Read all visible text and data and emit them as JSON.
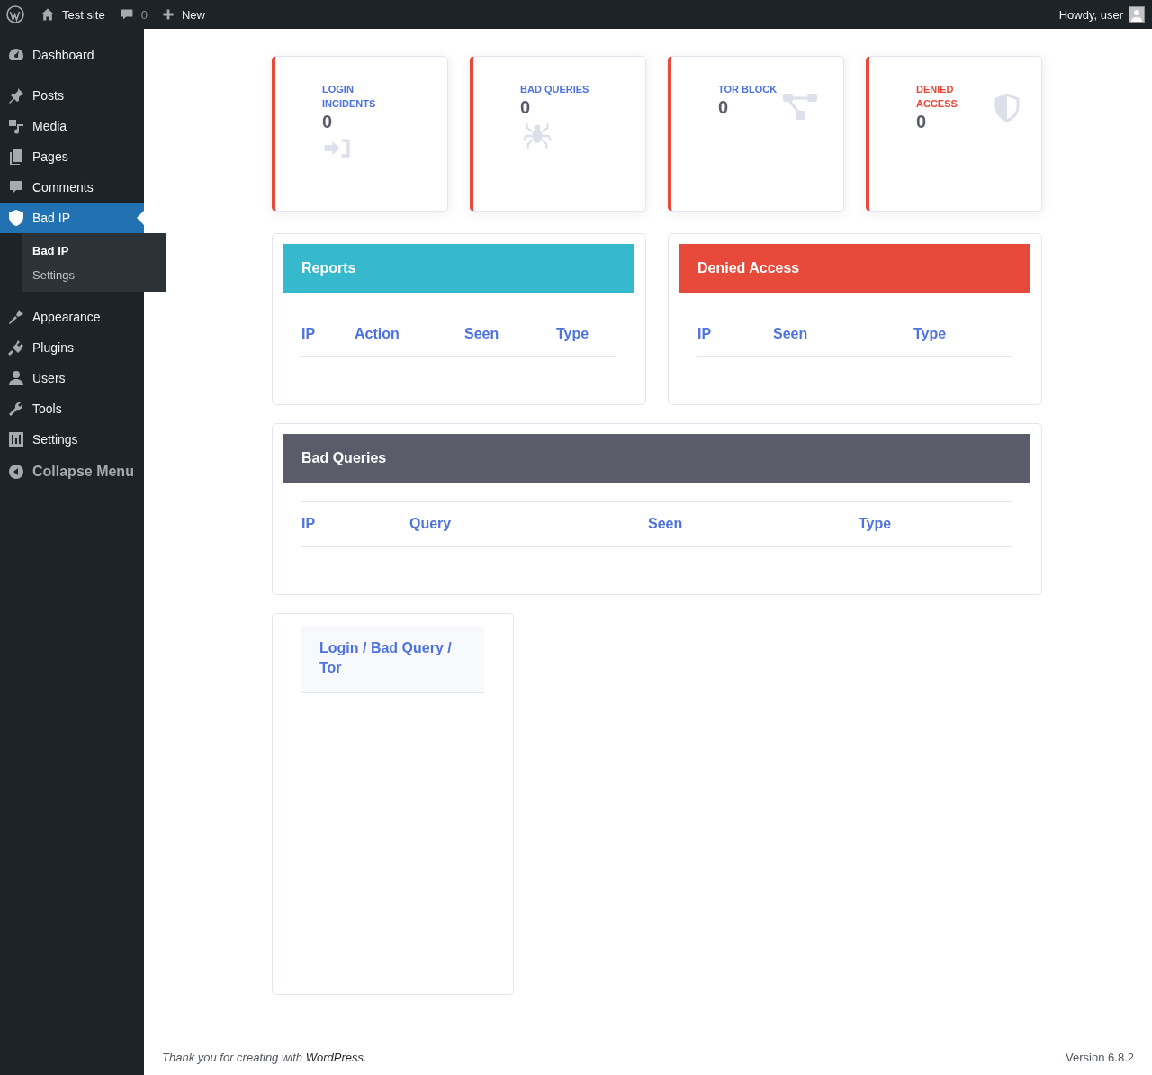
{
  "admin_bar": {
    "site": "Test site",
    "comments": "0",
    "new": "New",
    "greeting": "Howdy, user"
  },
  "sidebar": {
    "items": [
      {
        "label": "Dashboard",
        "selected": false
      },
      {
        "label": "Posts",
        "selected": false
      },
      {
        "label": "Media",
        "selected": false
      },
      {
        "label": "Pages",
        "selected": false
      },
      {
        "label": "Comments",
        "selected": false
      },
      {
        "label": "Bad IP",
        "selected": true,
        "children": [
          {
            "label": "Bad IP",
            "selected": true
          },
          {
            "label": "Settings",
            "selected": false
          }
        ]
      },
      {
        "label": "Appearance",
        "selected": false
      },
      {
        "label": "Plugins",
        "selected": false
      },
      {
        "label": "Users",
        "selected": false
      },
      {
        "label": "Tools",
        "selected": false
      },
      {
        "label": "Settings",
        "selected": false
      }
    ],
    "collapse": "Collapse Menu"
  },
  "stats": [
    {
      "label": "LOGIN INCIDENTS",
      "value": "0",
      "kind": "login",
      "color": "#4e73df"
    },
    {
      "label": "BAD QUERIES",
      "value": "0",
      "kind": "bug",
      "color": "#4e73df"
    },
    {
      "label": "TOR BLOCK",
      "value": "0",
      "kind": "network",
      "color": "#4e73df"
    },
    {
      "label": "DENIED ACCESS",
      "value": "0",
      "kind": "shield",
      "color": "#e74a3b"
    }
  ],
  "panels": [
    {
      "title": "Reports",
      "color": "#36b9cc",
      "columns": [
        "IP",
        "Action",
        "Seen",
        "Type"
      ]
    },
    {
      "title": "Denied Access",
      "color": "#e74a3b",
      "columns": [
        "IP",
        "Seen",
        "Type"
      ]
    },
    {
      "title": "Bad Queries",
      "color": "#5a5c69",
      "columns": [
        "IP",
        "Query",
        "Seen",
        "Type"
      ]
    }
  ],
  "chart_card": {
    "heading": "Login / Bad Query / Tor"
  },
  "footer": {
    "text_before": "Thank you for creating with ",
    "link": "WordPress",
    "text_after": ".",
    "version": "Version 6.8.2"
  }
}
